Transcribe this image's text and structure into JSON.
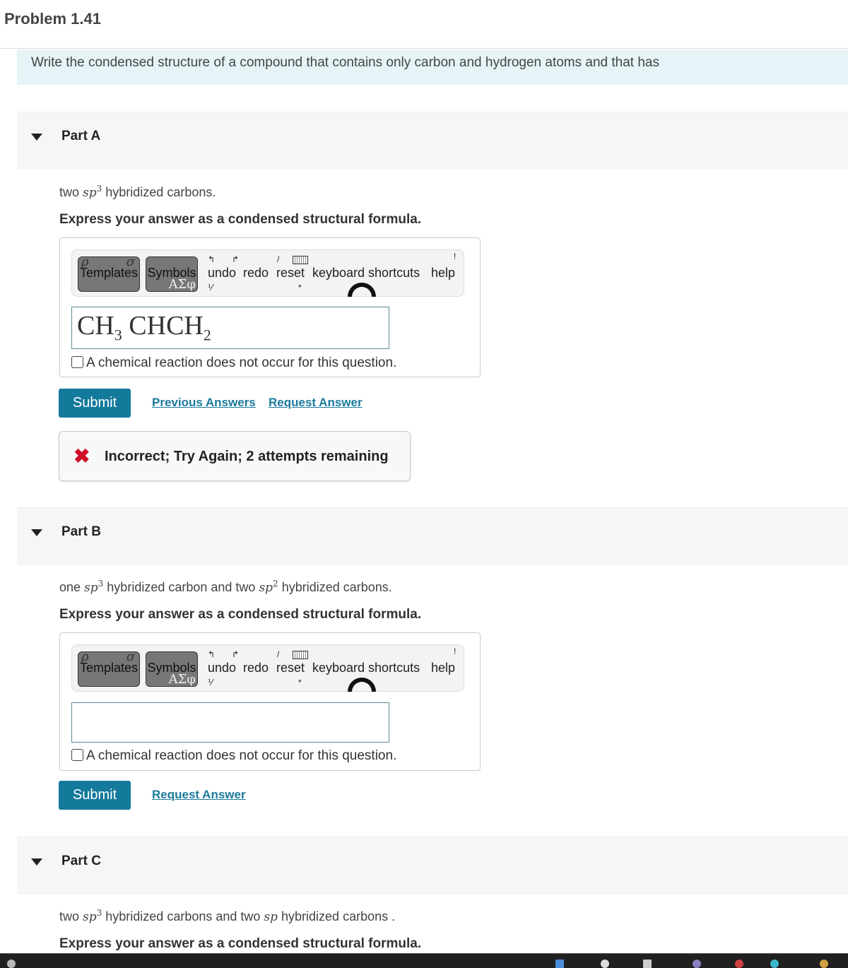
{
  "problem": {
    "title": "Problem 1.41",
    "intro": "Write the condensed structure of a compound that contains only carbon and hydrogen atoms and that has"
  },
  "toolbar": {
    "templates": "Templates",
    "symbols": "Symbols",
    "symbols_glyph": "ΑΣφ",
    "undo": "undo",
    "redo": "redo",
    "reset": "reset",
    "keyboard_shortcuts": "keyboard shortcuts",
    "help": "help"
  },
  "checkbox_label": "A chemical reaction does not occur for this question.",
  "instruction": "Express your answer as a condensed structural formula.",
  "parts": [
    {
      "label": "Part A",
      "question": {
        "pre": "two ",
        "term": "sp",
        "sup": "3",
        "post": " hybridized carbons."
      },
      "answer": {
        "a": "CH",
        "a_sub": "3",
        "b": " CHCH",
        "b_sub": "2"
      },
      "submit": "Submit",
      "links": [
        "Previous Answers",
        "Request Answer"
      ],
      "feedback": "Incorrect; Try Again; 2 attempts remaining"
    },
    {
      "label": "Part B",
      "question": {
        "pre": "one ",
        "term": "sp",
        "sup": "3",
        "mid": " hybridized carbon and two ",
        "term2": "sp",
        "sup2": "2",
        "post": " hybridized carbons."
      },
      "answer": "",
      "submit": "Submit",
      "links": [
        "Request Answer"
      ]
    },
    {
      "label": "Part C",
      "question": {
        "pre": "two ",
        "term": "sp",
        "sup": "3",
        "mid": " hybridized carbons and two ",
        "term2": "sp",
        "post": " hybridized carbons ."
      }
    }
  ],
  "colors": {
    "accent": "#147a9c",
    "error": "#d0102a",
    "intro_bg": "#e6f4f7"
  }
}
